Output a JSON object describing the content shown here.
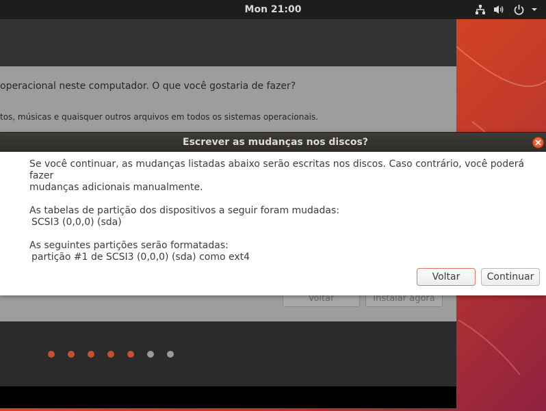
{
  "top_panel": {
    "clock": "Mon 21:00",
    "icons": [
      "network-icon",
      "volume-icon",
      "power-icon",
      "dropdown-arrow-icon"
    ]
  },
  "colors": {
    "accent": "#e95420",
    "installer_dark": "#2b2b2b",
    "installer_body": "#9d9d9d",
    "dot_active": "#c4532d",
    "dot_inactive": "#9a9a9a"
  },
  "installer": {
    "question": "operacional neste computador. O que você gostaria de fazer?",
    "sub_question": "tos, músicas e quaisquer outros arquivos em todos os sistemas operacionais.",
    "back_label": "Voltar",
    "install_label": "Instalar agora",
    "progress": {
      "completed_steps": 5,
      "total_steps": 7
    }
  },
  "dialog": {
    "title": "Escrever as mudanças nos discos?",
    "intro_line1": "Se você continuar, as mudanças listadas abaixo serão escritas nos discos. Caso contrário, você poderá fazer",
    "intro_line2": "mudanças adicionais manualmente.",
    "partition_tables_heading": "As tabelas de partição dos dispositivos a seguir foram mudadas:",
    "partition_tables_item": "SCSI3 (0,0,0) (sda)",
    "format_heading": "As seguintes partições serão formatadas:",
    "format_item": "partição #1 de SCSI3 (0,0,0) (sda) como ext4",
    "back_button": "Voltar",
    "continue_button": "Continuar"
  }
}
